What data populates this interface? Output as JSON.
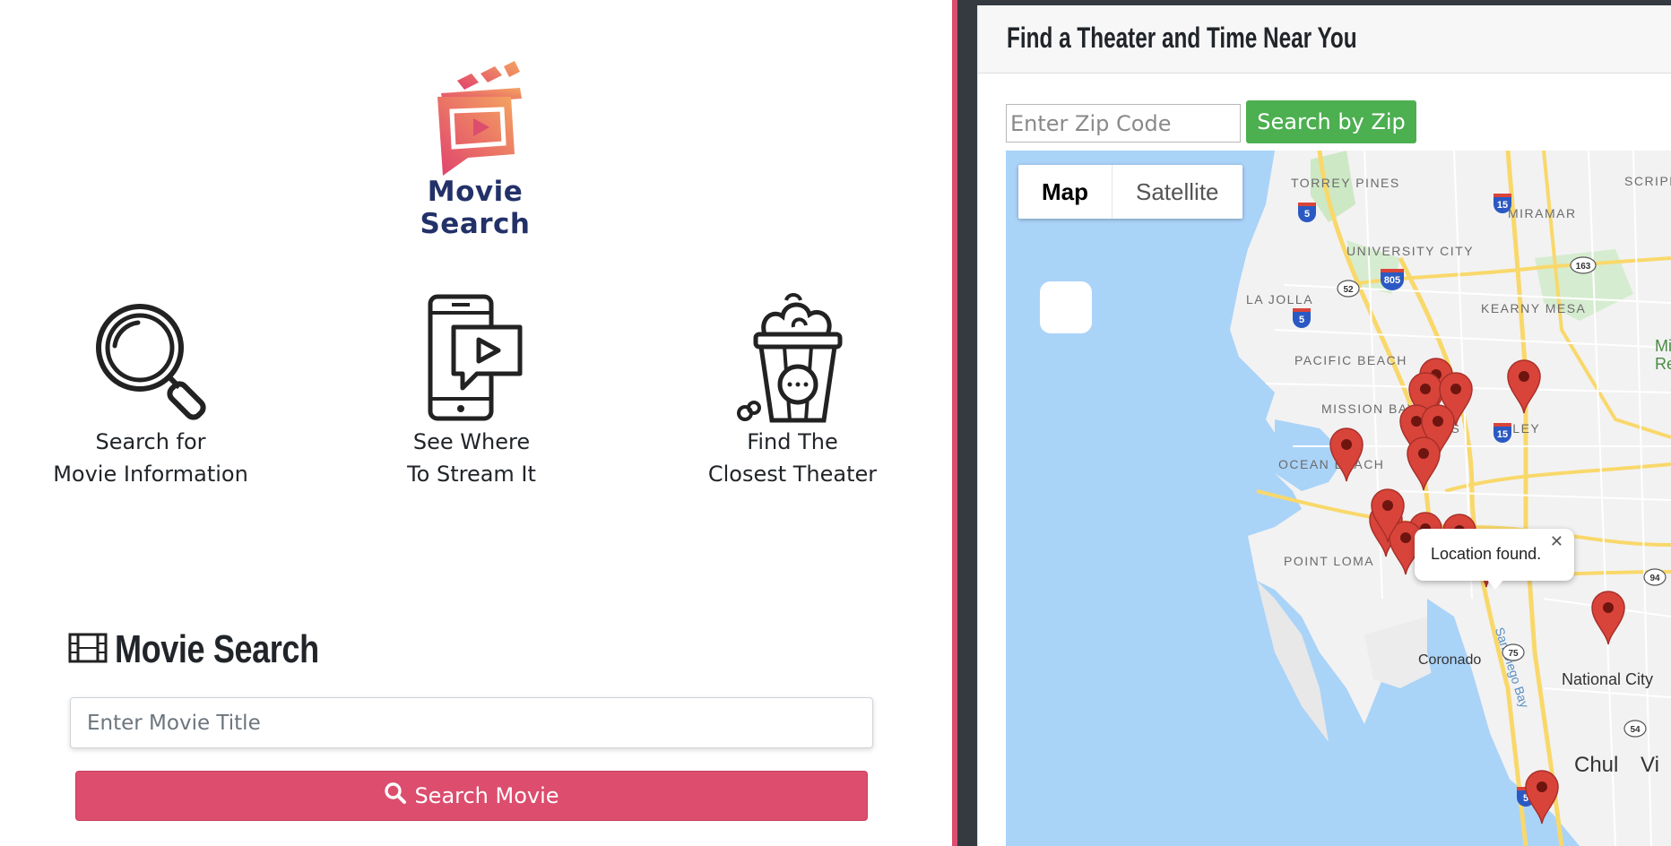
{
  "app": {
    "logo_text": "Movie Search"
  },
  "features": [
    {
      "icon": "magnifier-icon",
      "line1": "Search for",
      "line2": "Movie Information"
    },
    {
      "icon": "phone-stream-icon",
      "line1": "See Where",
      "line2": "To Stream It"
    },
    {
      "icon": "popcorn-icon",
      "line1": "Find The",
      "line2": "Closest Theater"
    }
  ],
  "movie_search": {
    "heading": "Movie Search",
    "heading_icon": "film-icon",
    "input_placeholder": "Enter Movie Title",
    "button_label": "Search Movie",
    "button_icon": "search-icon"
  },
  "theater": {
    "title": "Find a Theater and Time Near You",
    "zip_placeholder": "Enter Zip Code",
    "zip_button": "Search by Zip"
  },
  "map": {
    "type_options": [
      "Map",
      "Satellite"
    ],
    "selected_type": "Map",
    "popup_text": "Location found.",
    "area_labels": [
      "TORREY PINES",
      "MIRAMAR",
      "SCRIPP",
      "UNIVERSITY CITY",
      "LA JOLLA",
      "KEARNY MESA",
      "PACIFIC BEACH",
      "MISSION BAY",
      "MIS",
      "LLEY",
      "OCEAN BEACH",
      "POINT LOMA",
      "Mis",
      "Re"
    ],
    "city_labels": [
      "Coronado",
      "National City",
      "Chul",
      "Vi",
      "San Diego Bay"
    ],
    "downtown_label_parts": [
      "an",
      "iego"
    ],
    "highway_shields": [
      "5",
      "15",
      "805",
      "52",
      "163",
      "94",
      "75",
      "54"
    ],
    "pin_count": 16
  },
  "colors": {
    "accent": "#dc4d6e",
    "zip_button": "#4caf50",
    "water": "#aad3f8",
    "land": "#f2f2f2",
    "pin": "#d9443a"
  }
}
